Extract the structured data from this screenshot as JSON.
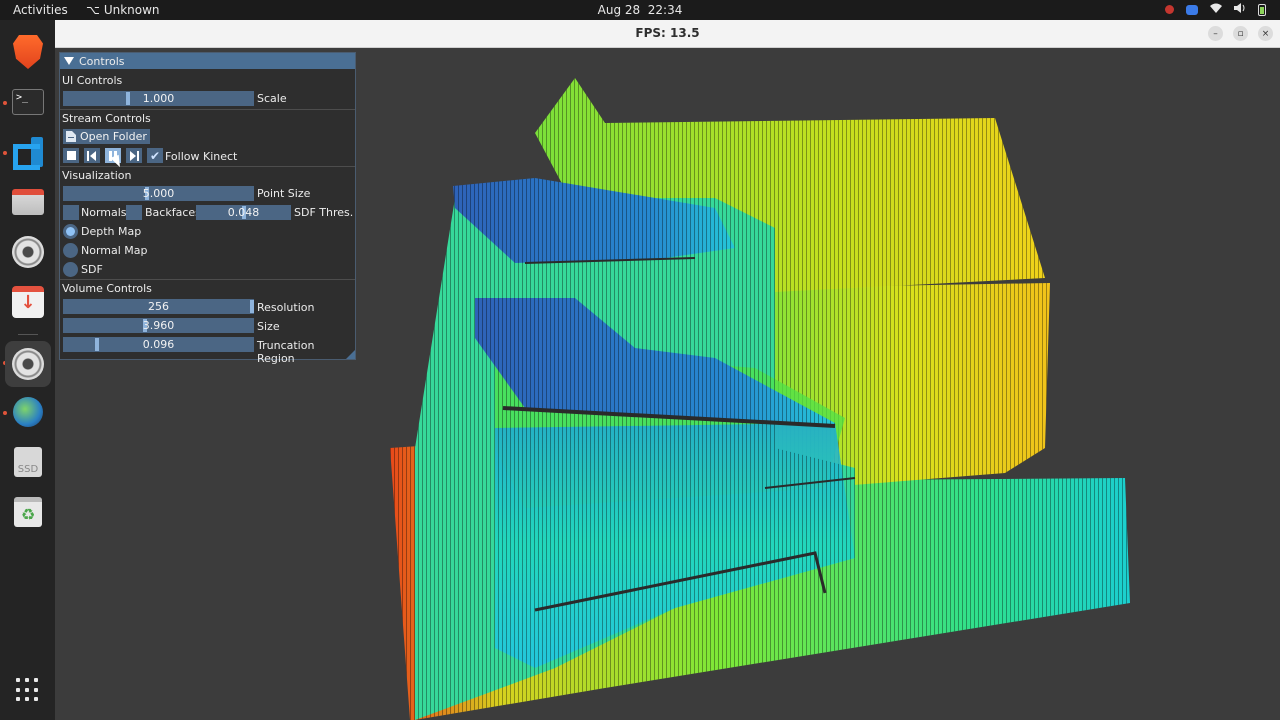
{
  "topbar": {
    "activities": "Activities",
    "app_name": "Unknown",
    "clock_date": "Aug 28",
    "clock_time": "22:34"
  },
  "dock": {
    "items": [
      "brave-browser",
      "terminal",
      "vscode",
      "files",
      "settings",
      "software-updater",
      "settings-active",
      "globe-app",
      "ssd-drive",
      "trash"
    ],
    "terminal_glyph": ">_",
    "ssd_label": "SSD",
    "trash_glyph": "♻"
  },
  "window": {
    "title": "FPS: 13.5",
    "minimize": "–",
    "maximize": "▫",
    "close": "×"
  },
  "panel": {
    "header": "Controls",
    "ui_controls": {
      "section": "UI Controls",
      "scale": {
        "value": "1.000",
        "label": "Scale",
        "fraction": 0.34
      }
    },
    "stream_controls": {
      "section": "Stream Controls",
      "open_folder": "Open Folder",
      "follow_kinect": "Follow Kinect",
      "follow_kinect_checked": true
    },
    "visualization": {
      "section": "Visualization",
      "point_size": {
        "value": "5.000",
        "label": "Point Size",
        "fraction": 0.44
      },
      "normals": "Normals",
      "backfaces": "Backfaces",
      "sdf_threshold": {
        "value": "0.048",
        "label": "SDF Thres.",
        "fraction": 0.5
      },
      "modes": [
        {
          "label": "Depth Map",
          "selected": true
        },
        {
          "label": "Normal Map",
          "selected": false
        },
        {
          "label": "SDF",
          "selected": false
        }
      ]
    },
    "volume_controls": {
      "section": "Volume Controls",
      "resolution": {
        "value": "256",
        "label": "Resolution",
        "fraction": 0.99
      },
      "size": {
        "value": "3.960",
        "label": "Size",
        "fraction": 0.43
      },
      "truncation_region": {
        "value": "0.096",
        "label": "Truncation Region",
        "fraction": 0.18
      }
    }
  },
  "colors": {
    "panel_accent": "#4a6f94",
    "slider_bg": "#4b6684",
    "slider_grab": "#8fb4dc",
    "depth_near": "#1f4fb8",
    "depth_mid": "#22e0b0",
    "depth_far": "#f3d21a",
    "depth_farthest": "#e8481a"
  }
}
